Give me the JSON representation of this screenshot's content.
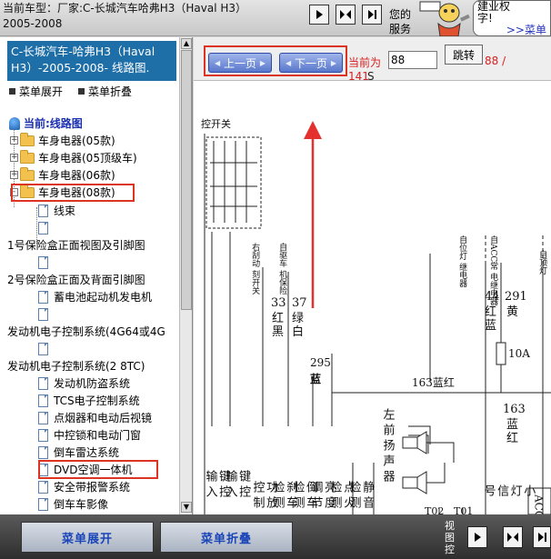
{
  "header": {
    "car_line1": "当前车型：厂家:C-长城汽车哈弗H3（Haval H3）",
    "car_line2": "2005-2008",
    "hello_line1": "您的",
    "hello_line2": "服务",
    "bubble_line1": "建业权",
    "bubble_line2": "字!",
    "bubble_link": ">>菜单"
  },
  "sidebar": {
    "car_title": "C-长城汽车-哈弗H3（Haval H3）-2005-2008- 线路图.",
    "expand_label": "菜单展开",
    "collapse_label": "菜单折叠",
    "tree": {
      "root": "当前:线路图",
      "folders": [
        "车身电器(05款)",
        "车身电器(05顶级车)",
        "车身电器(06款)",
        "车身电器(08款)"
      ],
      "items": [
        "线束",
        "1号保险盒正面视图及引脚图",
        "2号保险盒正面及背面引脚图",
        "蓄电池起动机发电机",
        "发动机电子控制系统(4G64或4G",
        "发动机电子控制系统(2 8TC)",
        "发动机防盗系统",
        "TCS电子控制系统",
        "点烟器和电动后视镜",
        "中控锁和电动门窗",
        "倒车雷达系统",
        "DVD空调一体机",
        "安全带报警系统",
        "倒车车影像"
      ]
    }
  },
  "navbar": {
    "prev_label": "上一页",
    "next_label": "下一页",
    "current_label": "当前为",
    "page_input": "88",
    "jump_label": "跳转",
    "current_page": "88 /",
    "total_pages": "141",
    "unit": "S"
  },
  "diagram": {
    "top_label": "控开关",
    "labels": {
      "a": "右刮动\n刻开关",
      "b": "自驱车\n机保险",
      "c": "自位灯\n继电器",
      "d": "自ACC常\n电继电器",
      "e": "自顶灯"
    },
    "wires": {
      "w33": "33",
      "w33c": "红\n黑",
      "w37": "37",
      "w37c": "绿\n白",
      "w295": "295",
      "w295c": "蓝",
      "w163a": "163蓝红",
      "w44": "44",
      "w44c": "红\n蓝",
      "w291": "291",
      "w291c": "黄",
      "fuse": "10A",
      "w163b": "163",
      "w163bc": "蓝\n红"
    },
    "speaker": "左前扬声器",
    "t02": "T02",
    "t02c": "棕",
    "t01": "T01",
    "t01c": "绿",
    "bottom_labels": [
      "键控输入",
      "键控输入",
      "功放控制",
      "刹车检测",
      "倒车检测",
      "亮度调节",
      "点火检测",
      "静音检测"
    ],
    "right_label": "小灯信号",
    "acc_label": "ACC"
  },
  "footer": {
    "expand_label": "菜单展开",
    "collapse_label": "菜单折叠",
    "view_ctrl": "视图控"
  }
}
